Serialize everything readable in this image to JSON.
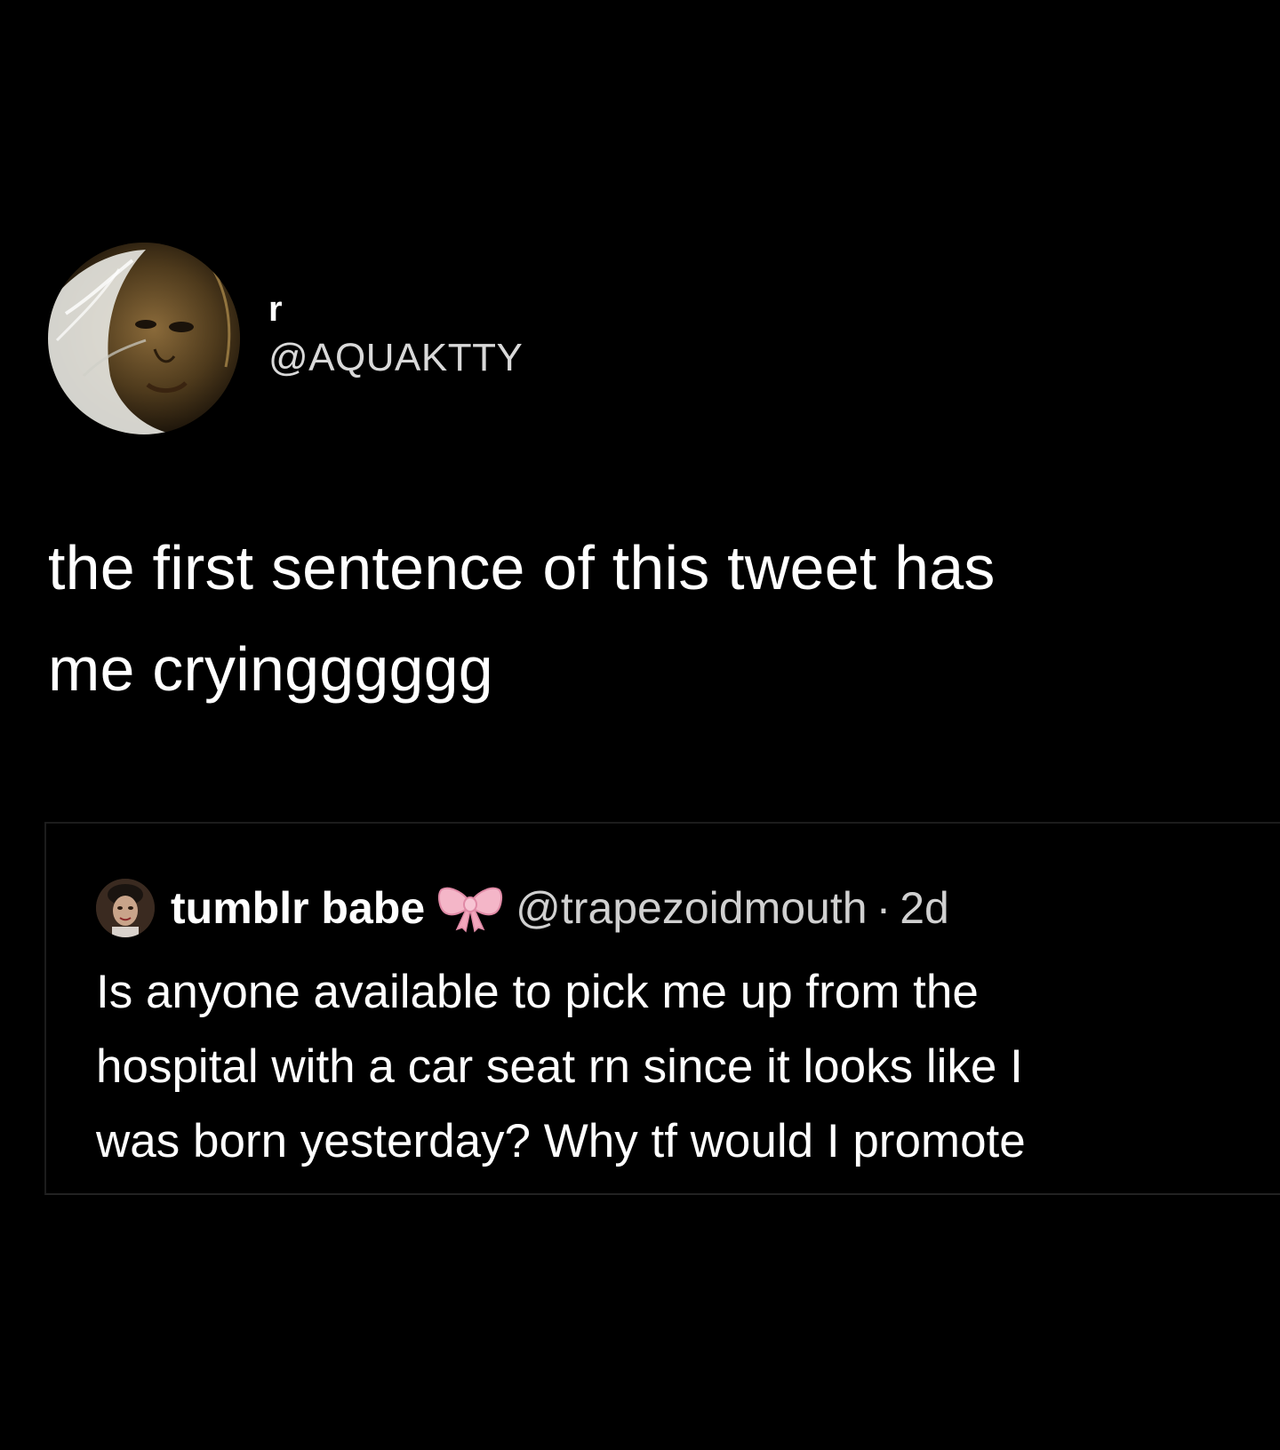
{
  "tweet": {
    "author": {
      "display_name": "r",
      "handle": "@AQUAKTTY",
      "avatar_icon": "profile-photo"
    },
    "text_line1": "the first sentence of this tweet has",
    "text_line2": "me cryingggggg",
    "background_color": "#000000",
    "text_color": "#ffffff"
  },
  "quoted_tweet": {
    "author": {
      "display_name": "tumblr babe",
      "emoji_icon": "pink-bow-icon",
      "handle": "@trapezoidmouth",
      "separator": "·",
      "time": "2d",
      "avatar_icon": "profile-photo"
    },
    "text_line1": "Is anyone available to pick me up from the",
    "text_line2": "hospital with a car seat rn since it looks like I",
    "text_line3": "was born yesterday? Why tf would I promote"
  }
}
